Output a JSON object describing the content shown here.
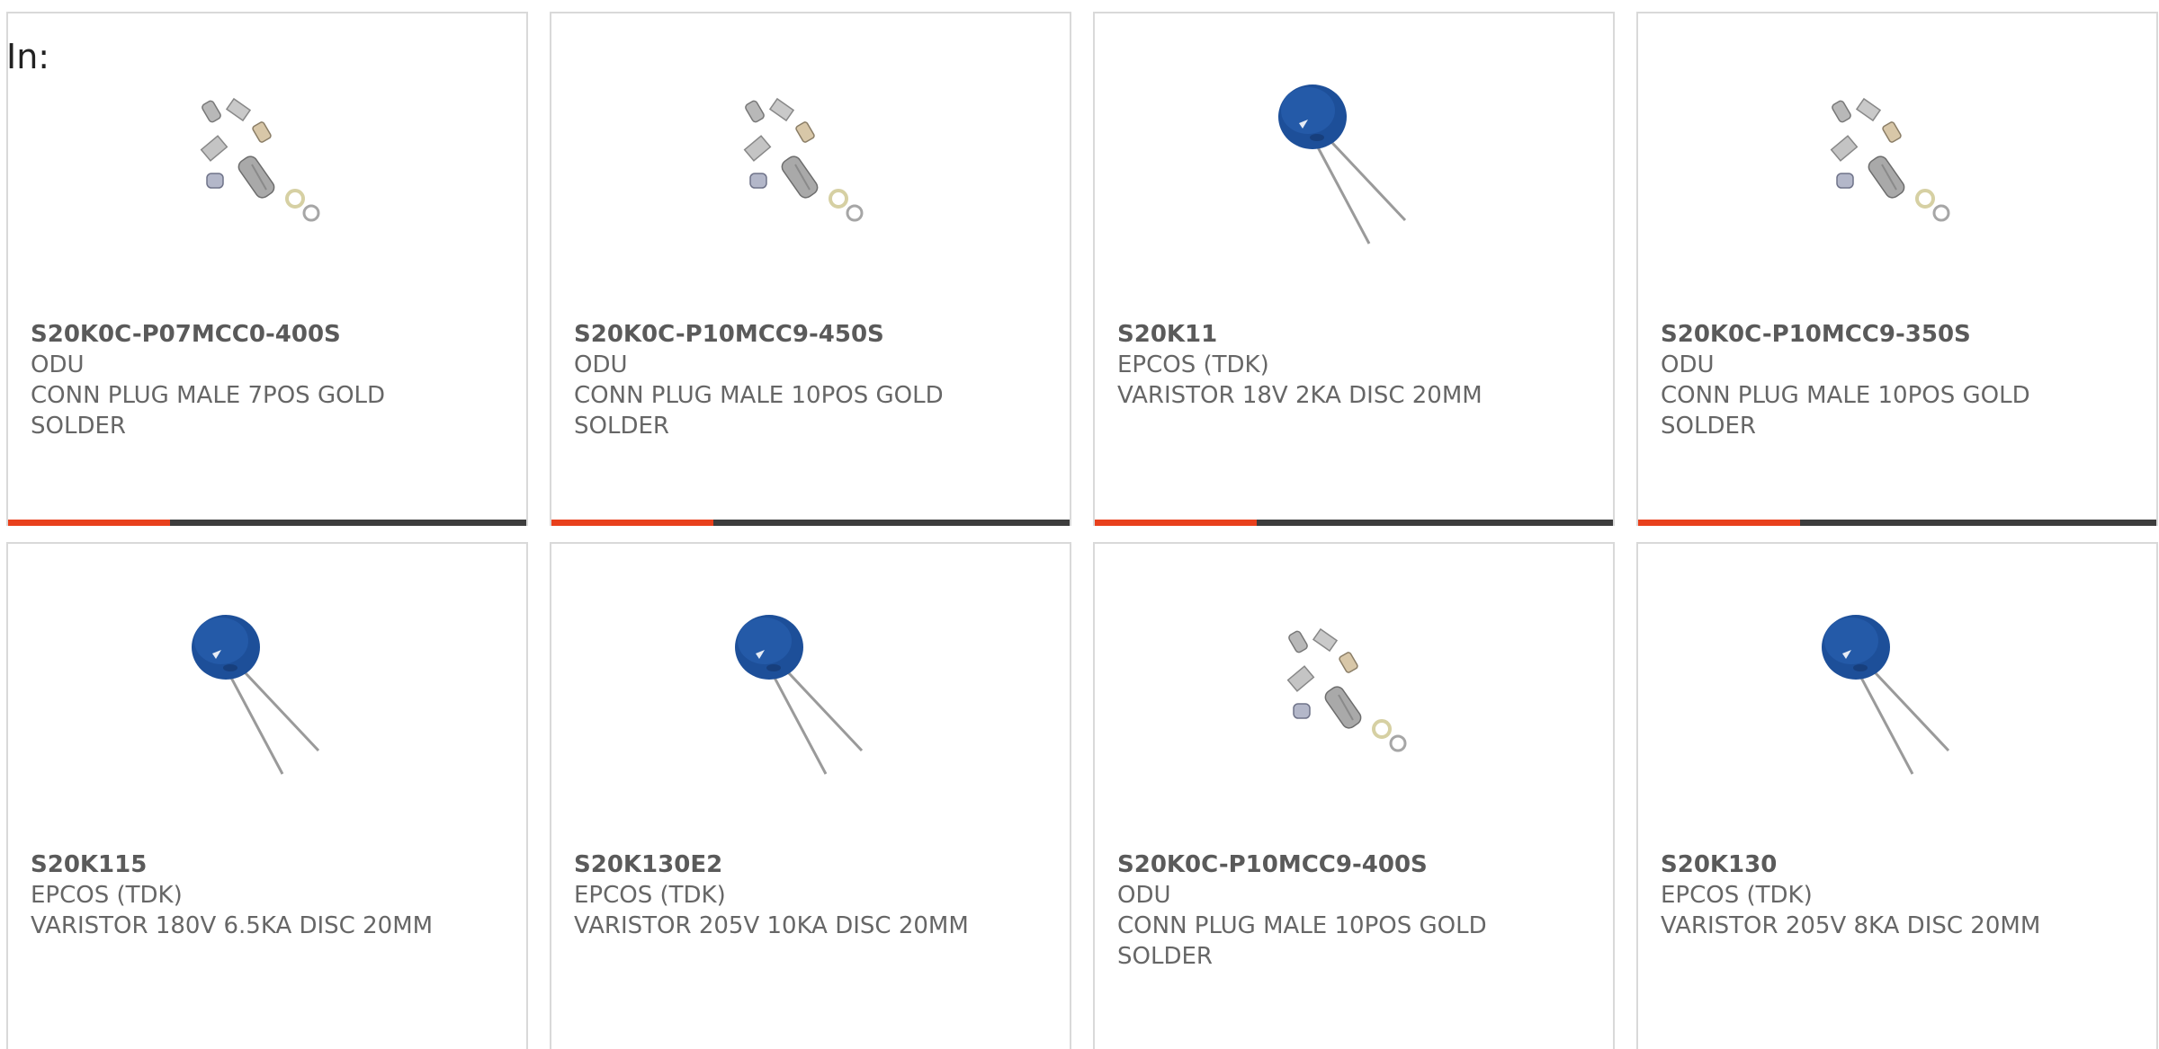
{
  "header": {
    "in_label": "In:"
  },
  "colors": {
    "accent": "#e8401c",
    "bar": "#3d3d3d",
    "text": "#666666"
  },
  "products": [
    {
      "part_number": "S20K0C-P07MCC0-400S",
      "manufacturer": "ODU",
      "description": "CONN PLUG MALE 7POS GOLD SOLDER",
      "image_icon": "connector-kit-icon"
    },
    {
      "part_number": "S20K0C-P10MCC9-450S",
      "manufacturer": "ODU",
      "description": "CONN PLUG MALE 10POS GOLD SOLDER",
      "image_icon": "connector-kit-icon"
    },
    {
      "part_number": "S20K11",
      "manufacturer": "EPCOS (TDK)",
      "description": "VARISTOR 18V 2KA DISC 20MM",
      "image_icon": "varistor-disc-icon"
    },
    {
      "part_number": "S20K0C-P10MCC9-350S",
      "manufacturer": "ODU",
      "description": "CONN PLUG MALE 10POS GOLD SOLDER",
      "image_icon": "connector-kit-icon"
    },
    {
      "part_number": "S20K115",
      "manufacturer": "EPCOS (TDK)",
      "description": "VARISTOR 180V 6.5KA DISC 20MM",
      "image_icon": "varistor-disc-icon"
    },
    {
      "part_number": "S20K130E2",
      "manufacturer": "EPCOS (TDK)",
      "description": "VARISTOR 205V 10KA DISC 20MM",
      "image_icon": "varistor-disc-icon"
    },
    {
      "part_number": "S20K0C-P10MCC9-400S",
      "manufacturer": "ODU",
      "description": "CONN PLUG MALE 10POS GOLD SOLDER",
      "image_icon": "connector-kit-icon"
    },
    {
      "part_number": "S20K130",
      "manufacturer": "EPCOS (TDK)",
      "description": "VARISTOR 205V 8KA DISC 20MM",
      "image_icon": "varistor-disc-icon"
    }
  ]
}
